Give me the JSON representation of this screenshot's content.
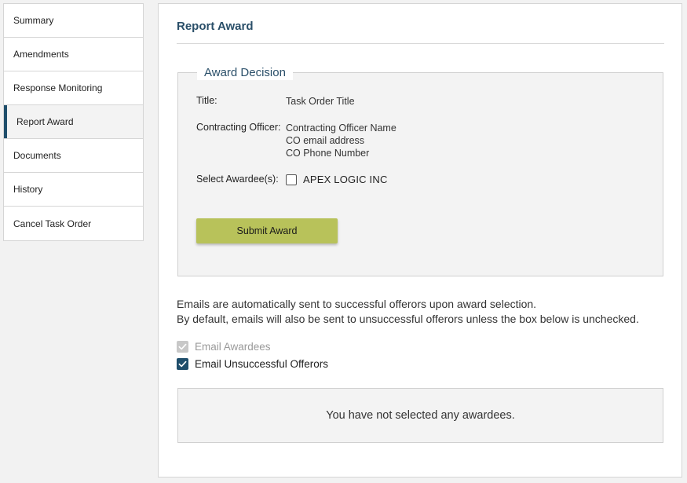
{
  "sidebar": {
    "items": [
      {
        "label": "Summary"
      },
      {
        "label": "Amendments"
      },
      {
        "label": "Response Monitoring"
      },
      {
        "label": "Report Award",
        "active": true
      },
      {
        "label": "Documents"
      },
      {
        "label": "History"
      },
      {
        "label": "Cancel Task Order"
      }
    ]
  },
  "main": {
    "title": "Report Award",
    "award_decision": {
      "legend": "Award Decision",
      "title_label": "Title:",
      "title_value": "Task Order Title",
      "officer_label": "Contracting Officer:",
      "officer_name": "Contracting Officer Name",
      "officer_email": "CO email address",
      "officer_phone": "CO Phone Number",
      "awardee_label": "Select Awardee(s):",
      "awardee_name": "APEX LOGIC INC",
      "awardee_checked": false,
      "submit_label": "Submit Award"
    },
    "note_line1": "Emails are automatically sent to successful offerors upon award selection.",
    "note_line2": "By default, emails will also be sent to unsuccessful offerors unless the box below is unchecked.",
    "email_awardees_label": "Email Awardees",
    "email_awardees_checked": true,
    "email_awardees_disabled": true,
    "email_unsuccessful_label": "Email Unsuccessful Offerors",
    "email_unsuccessful_checked": true,
    "no_awardee_message": "You have not selected any awardees."
  },
  "colors": {
    "accent": "#1f4e6b",
    "submit_button": "#b8c25a",
    "heading": "#2a4f69"
  },
  "icons": {
    "checkmark": "check-icon"
  }
}
